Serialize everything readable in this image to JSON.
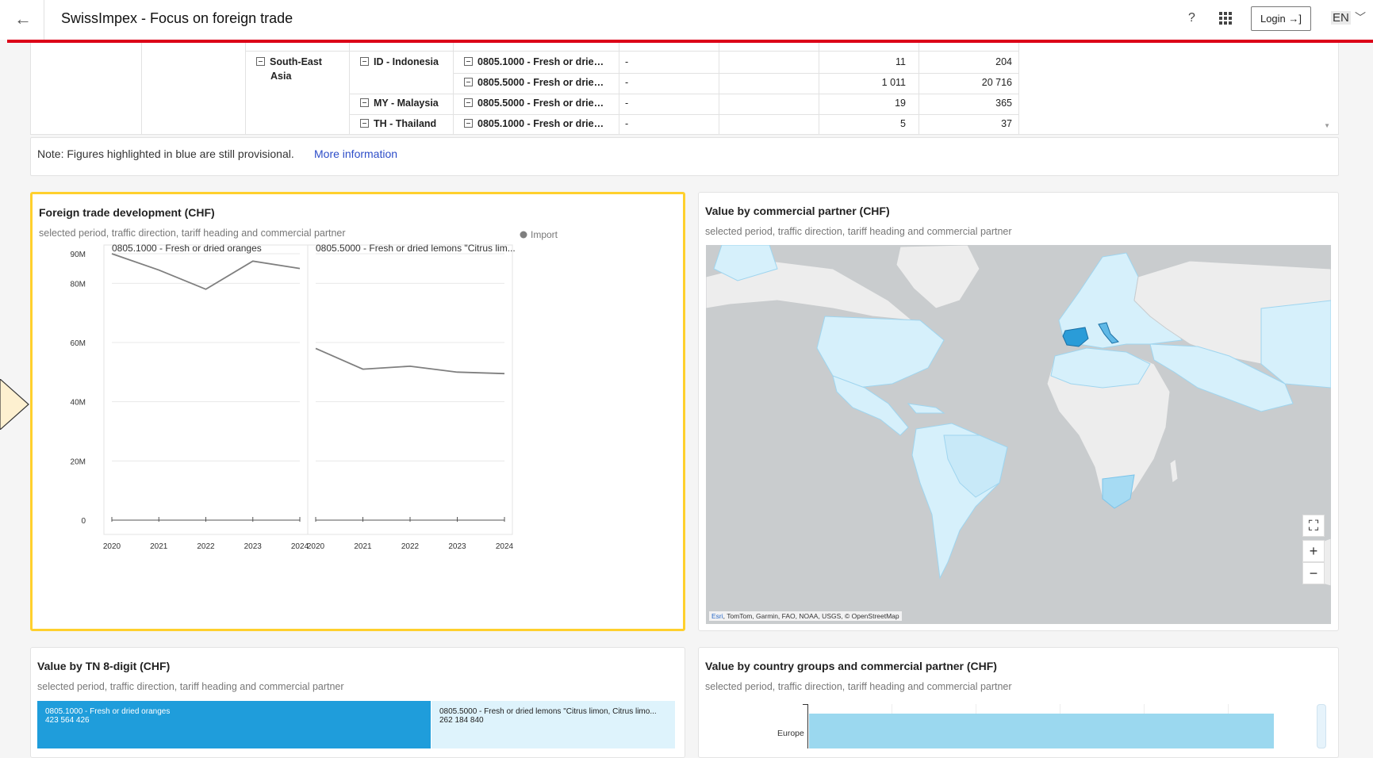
{
  "header": {
    "title": "SwissImpex - Focus on foreign trade",
    "back_icon": "arrow-left-icon",
    "help": "?",
    "login_label": "Login",
    "lang": "EN"
  },
  "table": {
    "rows": [
      {
        "region": "South-East Asia",
        "country": "ID - Indonesia",
        "tariff": "0805.1000 - Fresh or drie…",
        "col4": "-",
        "col5": "",
        "qty": "11",
        "value": "204"
      },
      {
        "region": "",
        "country": "",
        "tariff": "0805.5000 - Fresh or drie…",
        "col4": "-",
        "col5": "",
        "qty": "1 011",
        "value": "20 716"
      },
      {
        "region": "",
        "country": "MY - Malaysia",
        "tariff": "0805.5000 - Fresh or drie…",
        "col4": "-",
        "col5": "",
        "qty": "19",
        "value": "365"
      },
      {
        "region": "",
        "country": "TH - Thailand",
        "tariff": "0805.1000 - Fresh or drie…",
        "col4": "-",
        "col5": "",
        "qty": "5",
        "value": "37"
      }
    ],
    "region_line1": "South-East",
    "region_line2": "Asia"
  },
  "note": {
    "text": "Note: Figures highlighted in blue are still provisional.",
    "link": "More information"
  },
  "card_trade": {
    "title": "Foreign trade development (CHF)",
    "subtitle": "selected period, traffic direction, tariff heading and commercial partner"
  },
  "card_partner": {
    "title": "Value by commercial partner (CHF)",
    "subtitle": "selected period, traffic direction, tariff heading and commercial partner",
    "attribution_esri": "Esri",
    "attribution_rest": ", TomTom, Garmin, FAO, NOAA, USGS, © OpenStreetMap"
  },
  "card_tn": {
    "title": "Value by  TN 8-digit (CHF)",
    "subtitle": "selected period, traffic direction, tariff heading and commercial partner",
    "tiles": [
      {
        "label": "0805.1000 - Fresh or dried oranges",
        "value": "423 564 426"
      },
      {
        "label": "0805.5000 - Fresh or dried lemons \"Citrus limon, Citrus limo...",
        "value": "262 184 840"
      }
    ]
  },
  "card_groups": {
    "title": "Value by country groups and commercial partner (CHF)",
    "subtitle": "selected period, traffic direction, tariff heading and commercial partner",
    "category": "Europe"
  },
  "chart_data": {
    "type": "line",
    "legend": [
      "Import"
    ],
    "legend_position": "top-right",
    "panels": [
      {
        "name": "0805.1000 - Fresh or dried oranges",
        "x": [
          2020,
          2021,
          2022,
          2023,
          2024
        ],
        "values": [
          90000000,
          84500000,
          78000000,
          87500000,
          85000000
        ]
      },
      {
        "name": "0805.5000 - Fresh or dried lemons \"Citrus lim...",
        "x": [
          2020,
          2021,
          2022,
          2023,
          2024
        ],
        "values": [
          58000000,
          51000000,
          52000000,
          50000000,
          49500000
        ]
      }
    ],
    "yticks": [
      "0",
      "20M",
      "40M",
      "60M",
      "80M",
      "90M"
    ],
    "ylim": [
      0,
      90000000
    ],
    "grid": true,
    "color": "#7f7f7f"
  }
}
